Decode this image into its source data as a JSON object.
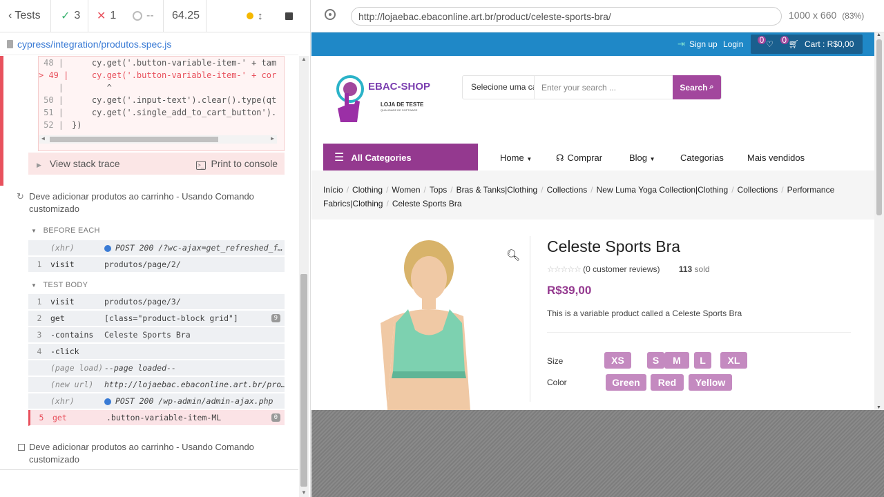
{
  "runner": {
    "back_label": "Tests",
    "passed": "3",
    "failed": "1",
    "pending": "--",
    "duration": "64.25",
    "spec_path": "cypress/integration/produtos.spec.js",
    "code_lines": [
      {
        "ln": "48 |",
        "text": "    cy.get('.button-variable-item-' + tam"
      },
      {
        "ln": "> 49 |",
        "text": "    cy.get('.button-variable-item-' + cor"
      },
      {
        "ln": "|",
        "text": "       ^"
      },
      {
        "ln": "50 |",
        "text": "    cy.get('.input-text').clear().type(qt"
      },
      {
        "ln": "51 |",
        "text": "    cy.get('.single_add_to_cart_button')."
      },
      {
        "ln": "52 |",
        "text": "})"
      }
    ],
    "view_stack_trace": "View stack trace",
    "print_to_console": "Print to console",
    "test1_title": "Deve adicionar produtos ao carrinho - Usando Comando customizado",
    "before_each": "BEFORE EACH",
    "test_body": "TEST BODY",
    "before_cmds": [
      {
        "n": "",
        "name": "(xhr)",
        "msg": "POST 200 /?wc-ajax=get_refreshed_f…",
        "dim": true,
        "dot": true
      },
      {
        "n": "1",
        "name": "visit",
        "msg": "produtos/page/2/"
      }
    ],
    "body_cmds": [
      {
        "n": "1",
        "name": "visit",
        "msg": "produtos/page/3/"
      },
      {
        "n": "2",
        "name": "get",
        "msg": "[class=\"product-block grid\"]",
        "badge": "9"
      },
      {
        "n": "3",
        "name": "-contains",
        "msg": "Celeste Sports Bra"
      },
      {
        "n": "4",
        "name": "-click",
        "msg": ""
      },
      {
        "n": "",
        "name": "(page load)",
        "msg": "--page loaded--",
        "dim": true
      },
      {
        "n": "",
        "name": "(new url)",
        "msg": "http://lojaebac.ebaconline.art.br/pro…",
        "dim": true
      },
      {
        "n": "",
        "name": "(xhr)",
        "msg": "POST 200 /wp-admin/admin-ajax.php",
        "dim": true,
        "dot": true
      },
      {
        "n": "5",
        "name": "get",
        "msg": ".button-variable-item-ML",
        "badge": "0",
        "err": true
      }
    ],
    "test2_title": "Deve adicionar produtos ao carrinho - Usando Comando customizado"
  },
  "browser": {
    "url": "http://lojaebac.ebaconline.art.br/product/celeste-sports-bra/",
    "viewport": "1000 x 660",
    "scale": "(83%)"
  },
  "shop": {
    "signup": "Sign up",
    "login": "Login",
    "wishlist_count": "0",
    "cart_count": "0",
    "cart_label": "Cart : R$0,00",
    "logo_name": "EBAC-SHOP",
    "logo_sub": "LOJA DE TESTE",
    "logo_sub2": "QUALIDADE DE SOFTWARE",
    "category_select": "Selecione uma cat",
    "search_placeholder": "Enter your search ...",
    "search_button": "Search",
    "all_categories": "All Categories",
    "menu": [
      "Home",
      "Comprar",
      "Blog",
      "Categorias",
      "Mais vendidos"
    ],
    "breadcrumbs": [
      "Início",
      "Clothing",
      "Women",
      "Tops",
      "Bras & Tanks|Clothing",
      "Collections",
      "New Luma Yoga Collection|Clothing",
      "Collections",
      "Performance Fabrics|Clothing",
      "Celeste Sports Bra"
    ],
    "product_title": "Celeste Sports Bra",
    "reviews": "(0 customer reviews)",
    "sold_count": "113",
    "sold_label": "sold",
    "price": "R$39,00",
    "description": "This is a variable product called a Celeste Sports Bra",
    "size_label": "Size",
    "sizes": [
      "XS",
      "S",
      "M",
      "L",
      "XL"
    ],
    "color_label": "Color",
    "colors": [
      "Green",
      "Red",
      "Yellow"
    ]
  },
  "colors": {
    "accent": "#94398f",
    "topbar": "#1f88c7",
    "fail": "#e8515d",
    "pass": "#3cb371"
  }
}
